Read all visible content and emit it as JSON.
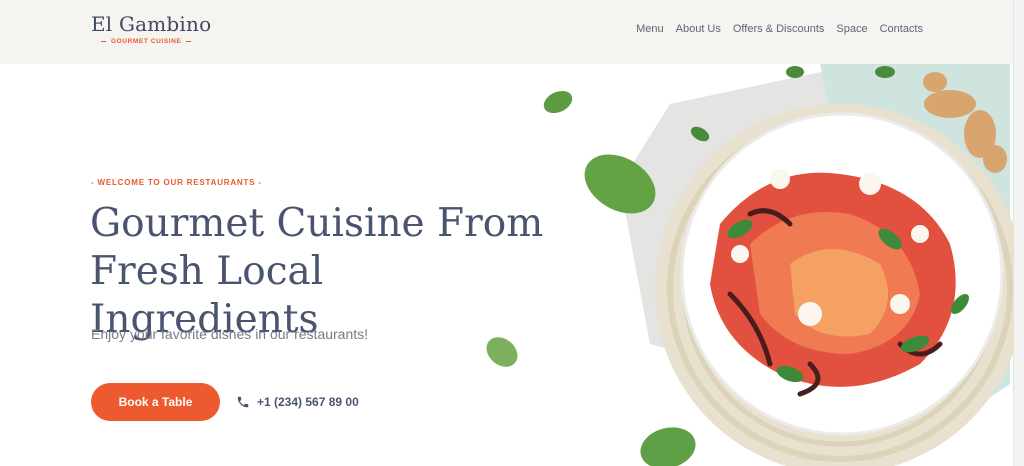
{
  "brand": {
    "name": "El Gambino",
    "tagline": "GOURMET CUISINE"
  },
  "nav": {
    "items": [
      "Menu",
      "About Us",
      "Offers & Discounts",
      "Space",
      "Contacts"
    ]
  },
  "hero": {
    "eyebrow": "- WELCOME TO OUR RESTAURANTS -",
    "headline": "Gourmet Cuisine From Fresh Local Ingredients",
    "subtext": "Enjoy your favorite dishes in our restaurants!",
    "cta_label": "Book a Table",
    "phone": "+1 (234) 567 89 00"
  },
  "colors": {
    "accent": "#ee5a2f",
    "heading": "#4a5470",
    "header_bg": "#f6f4f0"
  },
  "icons": {
    "phone": "phone-icon"
  }
}
